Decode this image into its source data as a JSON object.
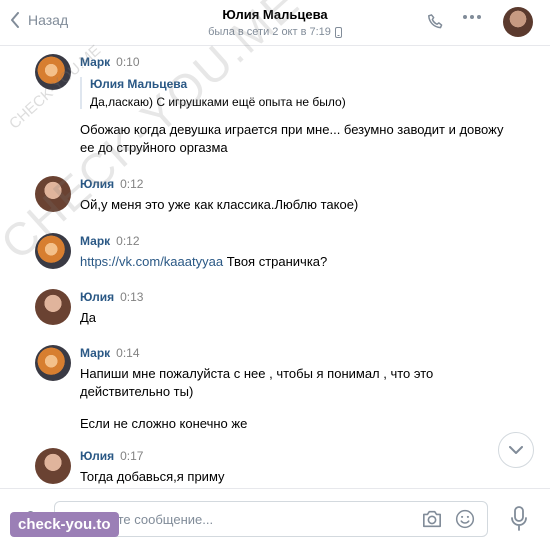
{
  "header": {
    "back_label": "Назад",
    "title": "Юлия Мальцева",
    "status": "была в сети 2 окт в 7:19"
  },
  "messages": [
    {
      "author": "Марк",
      "time": "0:10",
      "reply": {
        "author": "Юлия Мальцева",
        "text": "Да,ласкаю) С игрушками ещё опыта не было)"
      },
      "texts": [
        "Обожаю когда девушка играется при мне... безумно заводит и довожу ее до струйного оргазма"
      ]
    },
    {
      "author": "Юлия",
      "time": "0:12",
      "texts": [
        "Ой,у меня это уже как классика.Люблю такое)"
      ]
    },
    {
      "author": "Марк",
      "time": "0:12",
      "link": "https://vk.com/kaaatyyaa",
      "link_suffix": " Твоя страничка?"
    },
    {
      "author": "Юлия",
      "time": "0:13",
      "texts": [
        "Да"
      ]
    },
    {
      "author": "Марк",
      "time": "0:14",
      "texts": [
        "Напиши мне пожалуйста с нее , чтобы я понимал , что это действительно ты)",
        "Если не сложно конечно же"
      ]
    },
    {
      "author": "Юлия",
      "time": "0:17",
      "texts": [
        "Тогда добавься,я приму"
      ]
    }
  ],
  "composer": {
    "placeholder": "Напишите сообщение..."
  },
  "watermarks": {
    "diagonal": "CHECK-YOU.ME",
    "small": "CHECK-YOU.ME",
    "badge": "check-you.to"
  },
  "icons": {
    "back": "chevron-left-icon",
    "call": "phone-icon",
    "more": "more-icon",
    "scroll": "chevron-down-icon",
    "attach": "paperclip-icon",
    "camera": "camera-icon",
    "emoji": "smile-icon",
    "voice": "microphone-icon",
    "device": "phone-device-icon"
  },
  "colors": {
    "link": "#2a5885",
    "muted": "#818c99",
    "border": "#e7e8ec",
    "badge": "#9b7fb6"
  }
}
